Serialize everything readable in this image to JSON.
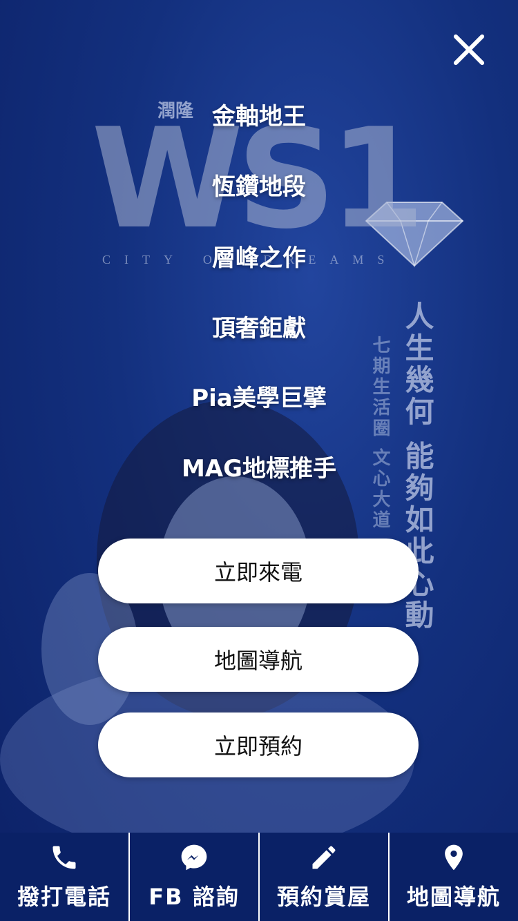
{
  "background": {
    "brand_mark": "潤隆",
    "logo": "WS1",
    "logo_tagline": "CITY OF DREAMS",
    "slogan_main": "人生幾何 能夠如此心動",
    "slogan_sub": "七期生活圈 文心大道 恆鑽"
  },
  "close_label": "close",
  "menu": {
    "items": [
      {
        "label": "金軸地王"
      },
      {
        "label": "恆鑽地段"
      },
      {
        "label": "層峰之作"
      },
      {
        "label": "頂奢鉅獻"
      },
      {
        "label": "Pia美學巨擘"
      },
      {
        "label": "MAG地標推手"
      }
    ]
  },
  "actions": {
    "call": "立即來電",
    "map": "地圖導航",
    "book": "立即預約"
  },
  "bottom_bar": {
    "tabs": [
      {
        "label": "撥打電話",
        "icon": "phone-icon"
      },
      {
        "label": "FB 諮詢",
        "icon": "messenger-icon"
      },
      {
        "label": "預約賞屋",
        "icon": "pencil-icon"
      },
      {
        "label": "地圖導航",
        "icon": "map-pin-icon"
      }
    ]
  },
  "colors": {
    "overlay": "#13307e",
    "bottom_bar": "#0a2166",
    "pill_bg": "#ffffff",
    "menu_text": "#ffffff"
  }
}
